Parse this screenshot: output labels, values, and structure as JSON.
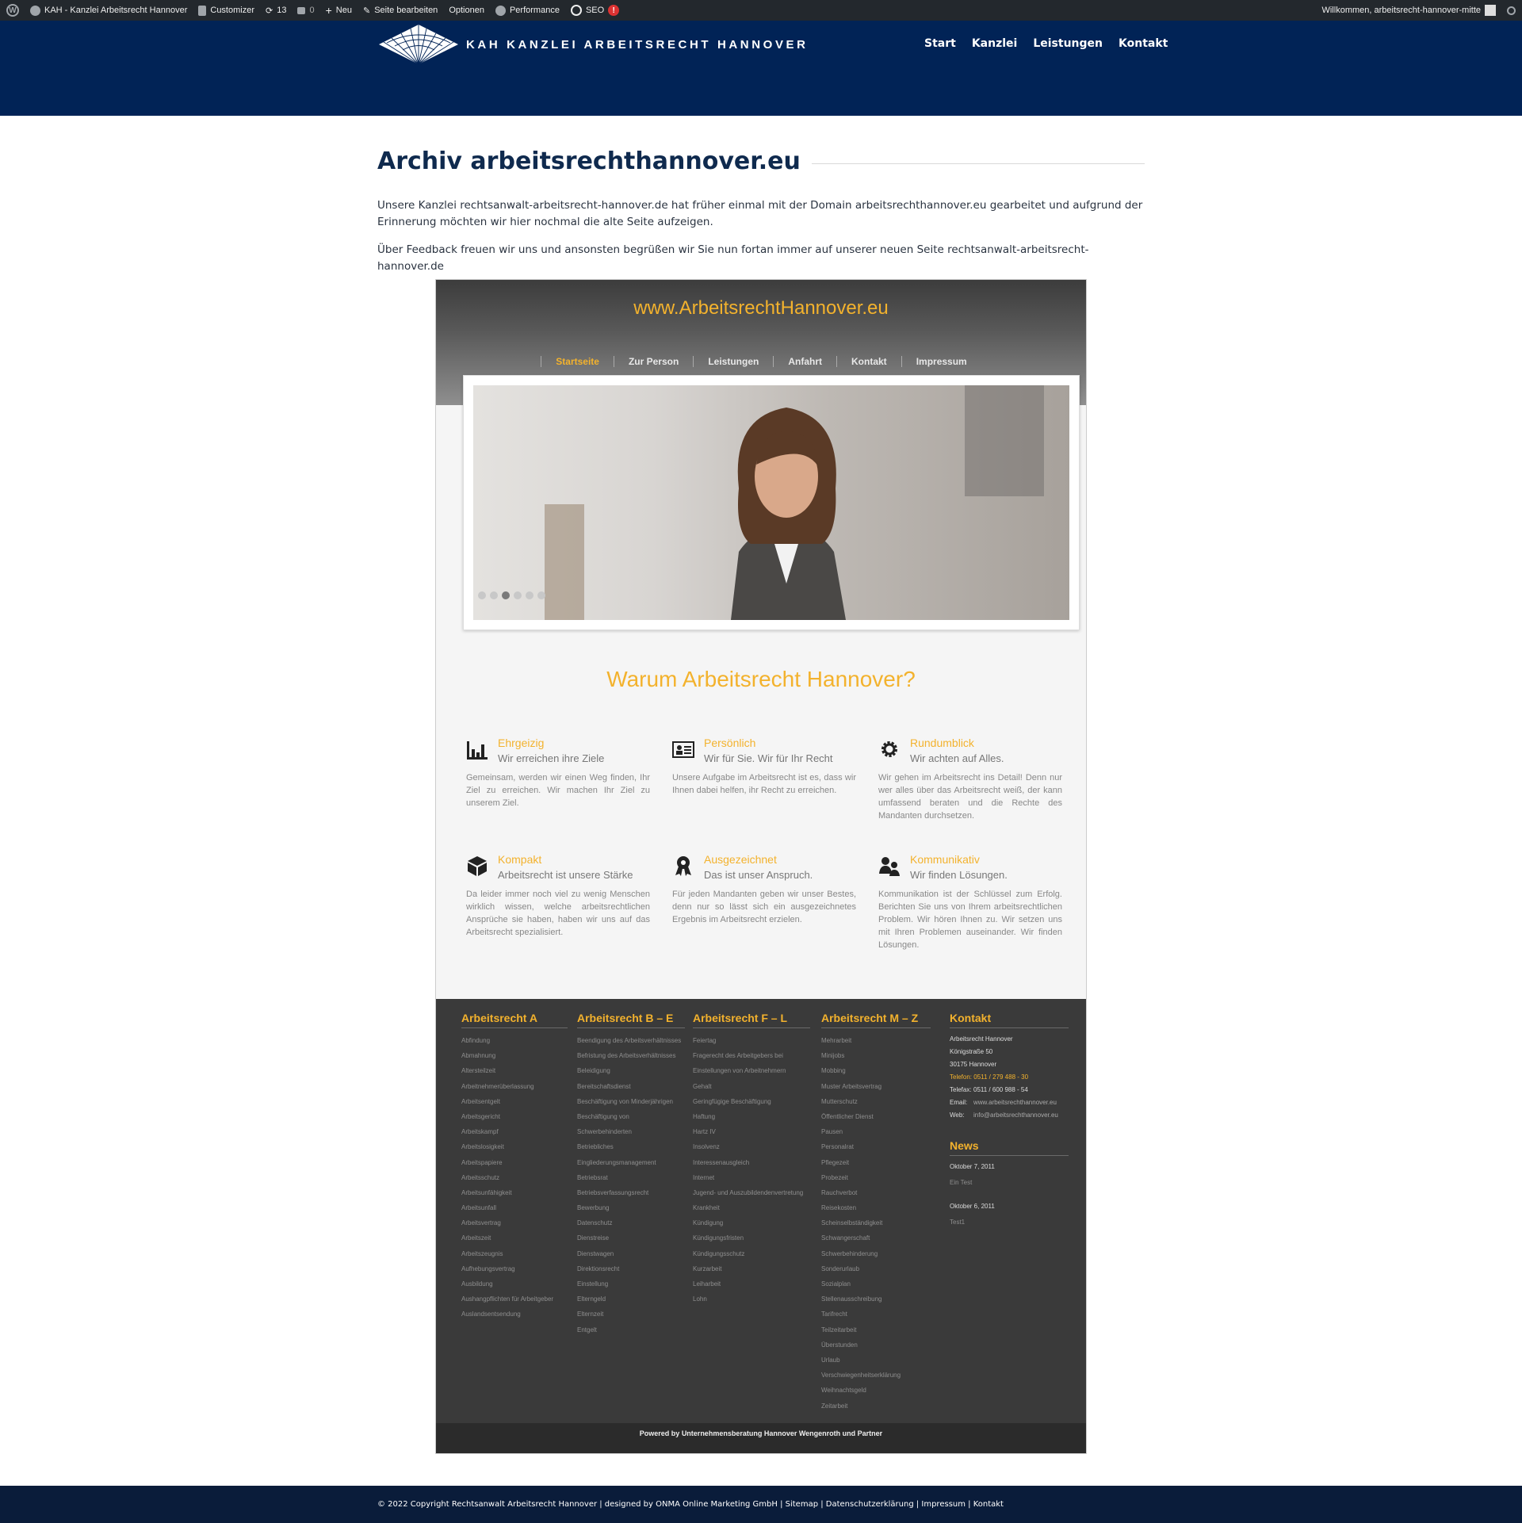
{
  "adminbar": {
    "site_name": "KAH - Kanzlei Arbeitsrecht Hannover",
    "customizer": "Customizer",
    "updates": "13",
    "comments": "0",
    "new": "Neu",
    "edit_page": "Seite bearbeiten",
    "options": "Optionen",
    "performance": "Performance",
    "seo": "SEO",
    "seo_badge": "!",
    "welcome": "Willkommen, arbeitsrecht-hannover-mitte"
  },
  "header": {
    "logo_text": "KAH KANZLEI ARBEITSRECHT HANNOVER",
    "nav": [
      "Start",
      "Kanzlei",
      "Leistungen",
      "Kontakt"
    ]
  },
  "content": {
    "title": "Archiv arbeitsrechthannover.eu",
    "paragraph1": "Unsere Kanzlei rechtsanwalt-arbeitsrecht-hannover.de hat früher einmal mit der Domain arbeitsrechthannover.eu gearbeitet und aufgrund der Erinnerung möchten wir hier nochmal die alte Seite aufzeigen.",
    "paragraph2": "Über Feedback freuen wir uns und ansonsten begrüßen wir Sie nun fortan immer auf unserer neuen Seite rechtsanwalt-arbeitsrecht-hannover.de"
  },
  "oldsite": {
    "title": "www.ArbeitsrechtHannover.eu",
    "nav": [
      "Startseite",
      "Zur Person",
      "Leistungen",
      "Anfahrt",
      "Kontakt",
      "Impressum"
    ],
    "why_title": "Warum Arbeitsrecht Hannover?",
    "features": [
      {
        "icon": "bar-chart-icon",
        "title": "Ehrgeizig",
        "subtitle": "Wir erreichen ihre Ziele",
        "text": "Gemeinsam, werden wir einen Weg finden, Ihr Ziel zu erreichen. Wir machen Ihr Ziel zu unserem Ziel."
      },
      {
        "icon": "id-card-icon",
        "title": "Persönlich",
        "subtitle": "Wir für Sie. Wir für Ihr Recht",
        "text": "Unsere Aufgabe im Arbeitsrecht ist es, dass wir Ihnen dabei helfen, ihr Recht zu erreichen."
      },
      {
        "icon": "gear-icon",
        "title": "Rundumblick",
        "subtitle": "Wir achten auf Alles.",
        "text": "Wir gehen im Arbeitsrecht ins Detail! Denn nur wer alles über das Arbeitsrecht weiß, der kann umfassend beraten und die Rechte des Mandanten durchsetzen."
      },
      {
        "icon": "cube-icon",
        "title": "Kompakt",
        "subtitle": "Arbeitsrecht ist unsere Stärke",
        "text": "Da leider immer noch viel zu wenig Menschen wirklich wissen, welche arbeitsrechtlichen Ansprüche sie haben, haben wir uns auf das Arbeitsrecht spezialisiert."
      },
      {
        "icon": "award-icon",
        "title": "Ausgezeichnet",
        "subtitle": "Das ist unser Anspruch.",
        "text": "Für jeden Mandanten geben wir unser Bestes, denn nur so lässt sich ein ausgezeichnetes Ergebnis im Arbeitsrecht erzielen."
      },
      {
        "icon": "users-icon",
        "title": "Kommunikativ",
        "subtitle": "Wir finden Lösungen.",
        "text": "Kommunikation ist der Schlüssel zum Erfolg. Berichten Sie uns von Ihrem arbeitsrechtlichen Problem. Wir hören Ihnen zu. Wir setzen uns mit Ihren Problemen auseinander. Wir finden Lösungen."
      }
    ],
    "footer_cols": [
      {
        "title": "Arbeitsrecht A",
        "items": [
          "Abfindung",
          "Abmahnung",
          "Altersteilzeit",
          "Arbeitnehmerüberlassung",
          "Arbeitsentgelt",
          "Arbeitsgericht",
          "Arbeitskampf",
          "Arbeitslosigkeit",
          "Arbeitspapiere",
          "Arbeitsschutz",
          "Arbeitsunfähigkeit",
          "Arbeitsunfall",
          "Arbeitsvertrag",
          "Arbeitszeit",
          "Arbeitszeugnis",
          "Aufhebungsvertrag",
          "Ausbildung",
          "Aushangpflichten für Arbeitgeber",
          "Auslandsentsendung"
        ]
      },
      {
        "title": "Arbeitsrecht B – E",
        "items": [
          "Beendigung des Arbeitsverhältnisses",
          "Befristung des Arbeitsverhältnisses",
          "Beleidigung",
          "Bereitschaftsdienst",
          "Beschäftigung von Minderjährigen",
          "Beschäftigung von",
          "Schwerbehinderten",
          "Betriebliches",
          "Eingliederungsmanagement",
          "Betriebsrat",
          "Betriebsverfassungsrecht",
          "Bewerbung",
          "Datenschutz",
          "Dienstreise",
          "Dienstwagen",
          "Direktionsrecht",
          "Einstellung",
          "Elterngeld",
          "Elternzeit",
          "Entgelt"
        ]
      },
      {
        "title": "Arbeitsrecht F – L",
        "items": [
          "Feiertag",
          "Fragerecht des Arbeitgebers bei",
          "Einstellungen von Arbeitnehmern",
          "Gehalt",
          "Geringfügige Beschäftigung",
          "Haftung",
          "Hartz IV",
          "Insolvenz",
          "Interessenausgleich",
          "Internet",
          "Jugend- und Auszubildendenvertretung",
          "Krankheit",
          "Kündigung",
          "Kündigungsfristen",
          "Kündigungsschutz",
          "Kurzarbeit",
          "Leiharbeit",
          "Lohn"
        ]
      },
      {
        "title": "Arbeitsrecht M – Z",
        "items": [
          "Mehrarbeit",
          "Minijobs",
          "Mobbing",
          "Muster Arbeitsvertrag",
          "Mutterschutz",
          "Öffentlicher Dienst",
          "Pausen",
          "Personalrat",
          "Pflegezeit",
          "Probezeit",
          "Rauchverbot",
          "Reisekosten",
          "Scheinselbständigkeit",
          "Schwangerschaft",
          "Schwerbehinderung",
          "Sonderurlaub",
          "Sozialplan",
          "Stellenausschreibung",
          "Tarifrecht",
          "Teilzeitarbeit",
          "Überstunden",
          "Urlaub",
          "Verschwiegenheitserklärung",
          "Weihnachtsgeld",
          "Zeitarbeit"
        ]
      }
    ],
    "kontakt": {
      "title": "Kontakt",
      "name": "Arbeitsrecht Hannover",
      "street": "Königstraße 50",
      "city": "30175 Hannover",
      "phone": "Telefon: 0511 / 279 488 - 30",
      "fax_label": "Telefax:",
      "fax": "0511 / 600 988 - 54",
      "email_label": "Email:",
      "email": "www.arbeitsrechthannover.eu",
      "web_label": "Web:",
      "web": "info@arbeitsrechthannover.eu"
    },
    "news": {
      "title": "News",
      "items": [
        {
          "date": "Oktober 7, 2011",
          "text": "Ein Test"
        },
        {
          "date": "Oktober 6, 2011",
          "text": "Test1"
        }
      ]
    },
    "copyright": "Powered by Unternehmensberatung Hannover Wengenroth und Partner"
  },
  "footer": {
    "text": "© 2022 Copyright Rechtsanwalt Arbeitsrecht Hannover | designed by ONMA Online Marketing GmbH | Sitemap | Datenschutzerklärung | Impressum | Kontakt"
  },
  "colors": {
    "navy": "#012356",
    "accent": "#f3b22d",
    "dark": "#3a3a3a"
  }
}
